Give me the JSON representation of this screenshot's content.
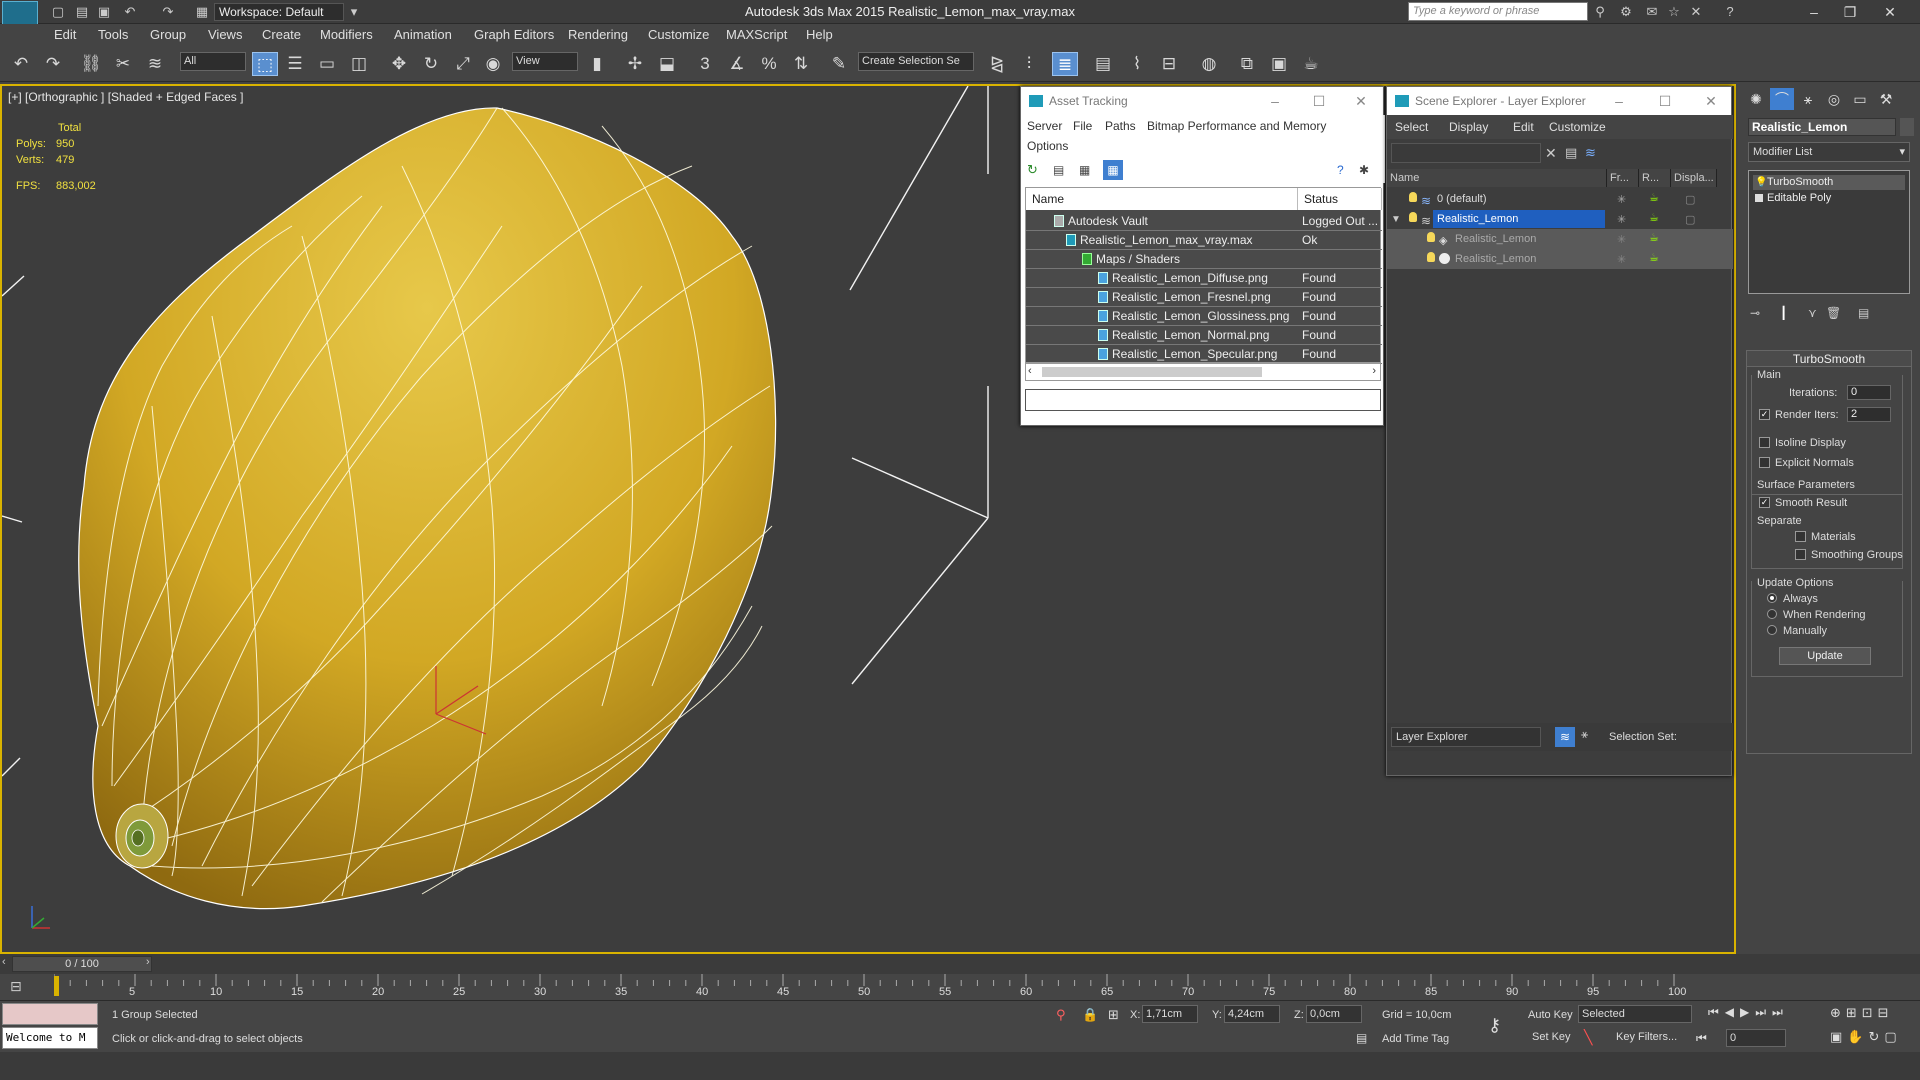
{
  "app": {
    "logo_text": "MAX",
    "title": "Autodesk 3ds Max  2015     Realistic_Lemon_max_vray.max",
    "workspace": "Workspace: Default",
    "search_placeholder": "Type a keyword or phrase"
  },
  "menu": [
    "Edit",
    "Tools",
    "Group",
    "Views",
    "Create",
    "Modifiers",
    "Animation",
    "Graph Editors",
    "Rendering",
    "Customize",
    "MAXScript",
    "Help"
  ],
  "toolbar": {
    "selection_filter": "All",
    "ref_coord": "View",
    "named_selection": "Create Selection Se"
  },
  "viewport": {
    "label": "[+] [Orthographic ] [Shaded + Edged Faces ]",
    "stats_total": "Total",
    "polys_label": "Polys:",
    "polys_value": "950",
    "verts_label": "Verts:",
    "verts_value": "479",
    "fps_label": "FPS:",
    "fps_value": "883,002"
  },
  "asset_tracking": {
    "title": "Asset Tracking",
    "menu": [
      "Server",
      "File",
      "Paths",
      "Bitmap Performance and Memory",
      "Options"
    ],
    "col_name": "Name",
    "col_status": "Status",
    "rows": [
      {
        "name": "Autodesk Vault",
        "status": "Logged Out ..."
      },
      {
        "name": "Realistic_Lemon_max_vray.max",
        "status": "Ok"
      },
      {
        "name": "Maps / Shaders",
        "status": ""
      },
      {
        "name": "Realistic_Lemon_Diffuse.png",
        "status": "Found"
      },
      {
        "name": "Realistic_Lemon_Fresnel.png",
        "status": "Found"
      },
      {
        "name": "Realistic_Lemon_Glossiness.png",
        "status": "Found"
      },
      {
        "name": "Realistic_Lemon_Normal.png",
        "status": "Found"
      },
      {
        "name": "Realistic_Lemon_Specular.png",
        "status": "Found"
      }
    ]
  },
  "scene_explorer": {
    "title": "Scene Explorer - Layer Explorer",
    "menu": [
      "Select",
      "Display",
      "Edit",
      "Customize"
    ],
    "cols": [
      "Name",
      "Fr...",
      "R...",
      "Displa..."
    ],
    "rows": [
      {
        "name": "0 (default)"
      },
      {
        "name": "Realistic_Lemon"
      },
      {
        "name": "Realistic_Lemon"
      },
      {
        "name": "Realistic_Lemon"
      }
    ],
    "layer_dropdown": "Layer Explorer",
    "selection_set_label": "Selection Set:"
  },
  "command_panel": {
    "object_name": "Realistic_Lemon",
    "modifier_list": "Modifier List",
    "stack": [
      "TurboSmooth",
      "Editable Poly"
    ],
    "rollout_title": "TurboSmooth",
    "main_label": "Main",
    "iterations_label": "Iterations:",
    "iterations_value": "0",
    "render_iters_label": "Render Iters:",
    "render_iters_value": "2",
    "isoline_label": "Isoline Display",
    "explicit_normals_label": "Explicit Normals",
    "surface_params_label": "Surface Parameters",
    "smooth_result_label": "Smooth Result",
    "separate_label": "Separate",
    "materials_label": "Materials",
    "smoothing_groups_label": "Smoothing Groups",
    "update_options_label": "Update Options",
    "always_label": "Always",
    "when_rendering_label": "When Rendering",
    "manually_label": "Manually",
    "update_button": "Update"
  },
  "timeline": {
    "slider_text": "0 / 100",
    "ticks": [
      "5",
      "10",
      "15",
      "20",
      "25",
      "30",
      "35",
      "40",
      "45",
      "50",
      "55",
      "60",
      "65",
      "70",
      "75",
      "80",
      "85",
      "90",
      "95",
      "100"
    ]
  },
  "status": {
    "maxscript_text": "Welcome to M",
    "selection_info": "1 Group Selected",
    "prompt": "Click or click-and-drag to select objects",
    "x_label": "X:",
    "x_value": "1,71cm",
    "y_label": "Y:",
    "y_value": "4,24cm",
    "z_label": "Z:",
    "z_value": "0,0cm",
    "grid": "Grid = 10,0cm",
    "add_time_tag": "Add Time Tag",
    "auto_key": "Auto Key",
    "set_key": "Set Key",
    "key_mode": "Selected",
    "key_filters": "Key Filters...",
    "frame": "0"
  }
}
